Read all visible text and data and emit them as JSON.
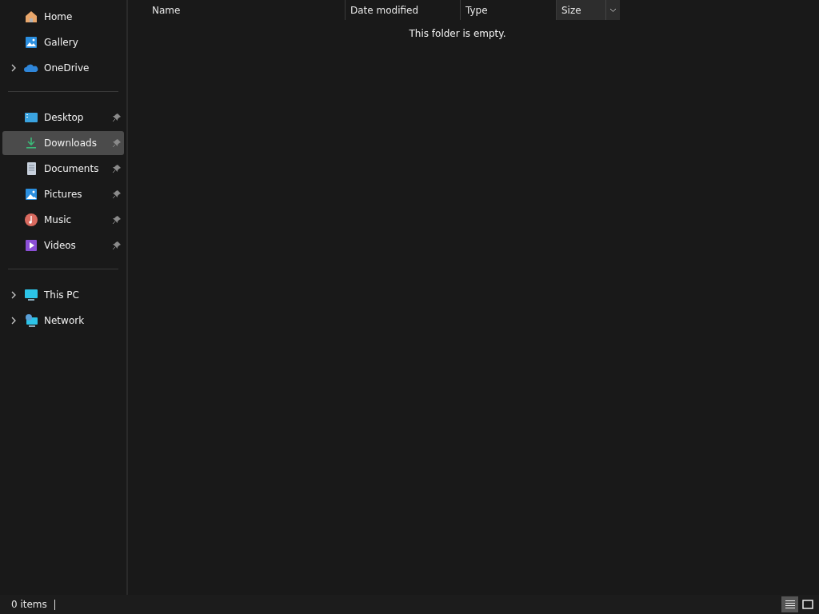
{
  "sidebar": {
    "groups": [
      {
        "items": [
          {
            "label": "Home",
            "expandable": false,
            "pinned": false,
            "selected": false
          },
          {
            "label": "Gallery",
            "expandable": false,
            "pinned": false,
            "selected": false
          },
          {
            "label": "OneDrive",
            "expandable": true,
            "pinned": false,
            "selected": false
          }
        ]
      },
      {
        "items": [
          {
            "label": "Desktop",
            "expandable": false,
            "pinned": true,
            "selected": false
          },
          {
            "label": "Downloads",
            "expandable": false,
            "pinned": true,
            "selected": true
          },
          {
            "label": "Documents",
            "expandable": false,
            "pinned": true,
            "selected": false
          },
          {
            "label": "Pictures",
            "expandable": false,
            "pinned": true,
            "selected": false
          },
          {
            "label": "Music",
            "expandable": false,
            "pinned": true,
            "selected": false
          },
          {
            "label": "Videos",
            "expandable": false,
            "pinned": true,
            "selected": false
          }
        ]
      },
      {
        "items": [
          {
            "label": "This PC",
            "expandable": true,
            "pinned": false,
            "selected": false
          },
          {
            "label": "Network",
            "expandable": true,
            "pinned": false,
            "selected": false
          }
        ]
      }
    ]
  },
  "table": {
    "columns": [
      {
        "label": "Name",
        "hovered": false
      },
      {
        "label": "Date modified",
        "hovered": false
      },
      {
        "label": "Type",
        "hovered": false
      },
      {
        "label": "Size",
        "hovered": true
      }
    ],
    "empty_message": "This folder is empty."
  },
  "status_bar": {
    "count": "0 items",
    "views": [
      {
        "kind": "details",
        "selected": true
      },
      {
        "kind": "tiles",
        "selected": false
      }
    ]
  }
}
